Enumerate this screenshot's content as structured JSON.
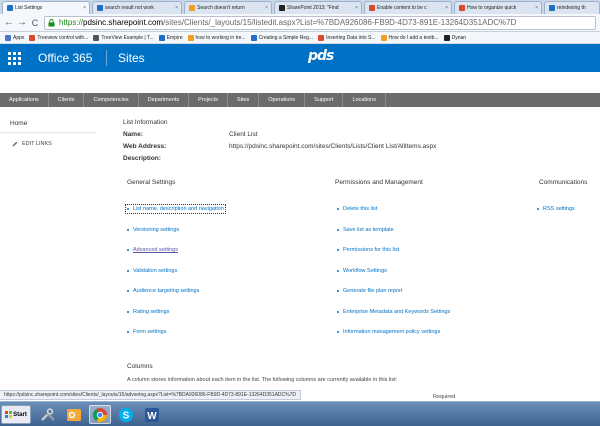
{
  "browser": {
    "tabs": [
      {
        "label": "List Settings",
        "color": "#1e6fc5"
      },
      {
        "label": "search result not work",
        "color": "#1e6fc5"
      },
      {
        "label": "Search doesn't return",
        "color": "#f0a020"
      },
      {
        "label": "SharePoint 2013: \"Find",
        "color": "#222222"
      },
      {
        "label": "Enable content to be c",
        "color": "#d84a2a"
      },
      {
        "label": "How to organize quick",
        "color": "#d84a2a"
      },
      {
        "label": "reindexing th",
        "color": "#1e6fc5"
      }
    ],
    "tab_close": "×",
    "url_scheme": "https://",
    "url_host": "pdsinc.sharepoint.com",
    "url_path": "/sites/Clients/_layouts/15/listedit.aspx?List=%7BDA926086-FB9D-4D73-891E-13264D351ADC%7D",
    "back_glyph": "←",
    "forward_glyph": "→",
    "reload_glyph": "C"
  },
  "bookmarks": [
    {
      "label": "Apps",
      "color": "#4a78c8"
    },
    {
      "label": "Treeview control with...",
      "color": "#d84a2a"
    },
    {
      "label": "TreeView Example | T...",
      "color": "#555555"
    },
    {
      "label": "Empire",
      "color": "#1e6fc5"
    },
    {
      "label": "how to working in tre...",
      "color": "#f0a020"
    },
    {
      "label": "Creating a Simple Reg...",
      "color": "#1e6fc5"
    },
    {
      "label": "Inserting Data into S...",
      "color": "#d84a2a"
    },
    {
      "label": "How do I add a textb...",
      "color": "#f0a020"
    },
    {
      "label": "Dynan",
      "color": "#222222"
    }
  ],
  "suite": {
    "brand": "Office 365",
    "app": "Sites",
    "logo": "pds",
    "accent": "#0072c6"
  },
  "topnav": [
    "Applications",
    "Clients",
    "Competencies",
    "Departments",
    "Projects",
    "Sites",
    "Operations",
    "Support",
    "Locations"
  ],
  "leftnav": {
    "home": "Home",
    "edit_links": "EDIT LINKS"
  },
  "list_info": {
    "heading": "List Information",
    "name_label": "Name:",
    "name_value": "Client List",
    "address_label": "Web Address:",
    "address_value": "https://pdsinc.sharepoint.com/sites/Clients/Lists/Client List/AllItems.aspx",
    "description_label": "Description:"
  },
  "general_settings": {
    "heading": "General Settings",
    "links": [
      "List name, description and navigation",
      "Versioning settings",
      "Advanced settings",
      "Validation settings",
      "Audience targeting settings",
      "Rating settings",
      "Form settings"
    ]
  },
  "permissions": {
    "heading": "Permissions and Management",
    "links": [
      "Delete this list",
      "Save list as template",
      "Permissions for this list",
      "Workflow Settings",
      "Generate file plan report",
      "Enterprise Metadata and Keywords Settings",
      "Information management policy settings"
    ]
  },
  "communications": {
    "heading": "Communications",
    "links": [
      "RSS settings"
    ]
  },
  "columns": {
    "heading": "Columns",
    "description": "A column stores information about each item in the list. The following columns are currently available in this list:",
    "required_label": "Required"
  },
  "status_url": "https://pdsinc.sharepoint.com/sites/Clients/_layouts/15/advsetng.aspx?List=%7BDA926086-FB9D-4D73-891E-13264D351ADC%7D",
  "taskbar": {
    "start_label": "Start"
  }
}
